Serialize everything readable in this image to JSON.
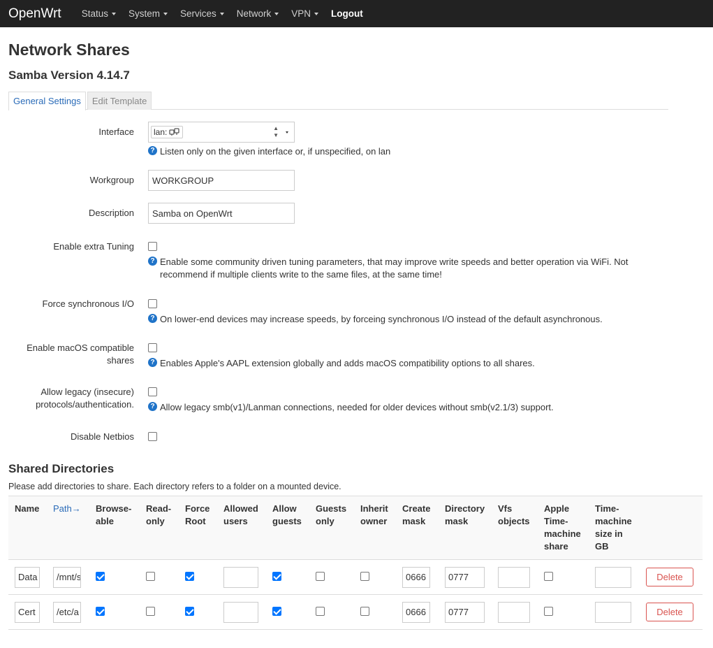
{
  "nav": {
    "brand": "OpenWrt",
    "items": [
      {
        "label": "Status",
        "dropdown": true
      },
      {
        "label": "System",
        "dropdown": true
      },
      {
        "label": "Services",
        "dropdown": true
      },
      {
        "label": "Network",
        "dropdown": true
      },
      {
        "label": "VPN",
        "dropdown": true
      }
    ],
    "logout": "Logout"
  },
  "page": {
    "title": "Network Shares",
    "subtitle": "Samba Version 4.14.7"
  },
  "tabs": [
    {
      "label": "General Settings",
      "active": true
    },
    {
      "label": "Edit Template",
      "active": false
    }
  ],
  "settings": {
    "interface": {
      "label": "Interface",
      "value": "lan:",
      "help": "Listen only on the given interface or, if unspecified, on lan"
    },
    "workgroup": {
      "label": "Workgroup",
      "value": "WORKGROUP"
    },
    "description": {
      "label": "Description",
      "value": "Samba on OpenWrt"
    },
    "extra_tuning": {
      "label": "Enable extra Tuning",
      "checked": false,
      "help": "Enable some community driven tuning parameters, that may improve write speeds and better operation via WiFi. Not recommend if multiple clients write to the same files, at the same time!"
    },
    "sync_io": {
      "label": "Force synchronous I/O",
      "checked": false,
      "help": "On lower-end devices may increase speeds, by forceing synchronous I/O instead of the default asynchronous."
    },
    "macos": {
      "label": "Enable macOS compatible shares",
      "checked": false,
      "help": "Enables Apple's AAPL extension globally and adds macOS compatibility options to all shares."
    },
    "legacy": {
      "label": "Allow legacy (insecure) protocols/authentication.",
      "checked": false,
      "help": "Allow legacy smb(v1)/Lanman connections, needed for older devices without smb(v2.1/3) support."
    },
    "netbios": {
      "label": "Disable Netbios",
      "checked": false
    }
  },
  "shared": {
    "title": "Shared Directories",
    "description": "Please add directories to share. Each directory refers to a folder on a mounted device.",
    "columns": {
      "name": "Name",
      "path": "Path→",
      "browseable": "Browse-able",
      "readonly": "Read-only",
      "forceroot": "Force Root",
      "allowed_users": "Allowed users",
      "allow_guests": "Allow guests",
      "guests_only": "Guests only",
      "inherit_owner": "Inherit owner",
      "create_mask": "Create mask",
      "dir_mask": "Directory mask",
      "vfs": "Vfs objects",
      "timemachine": "Apple Time-machine share",
      "tm_size": "Time-machine size in GB"
    },
    "rows": [
      {
        "name": "Data",
        "path": "/mnt/s",
        "browseable": true,
        "readonly": false,
        "forceroot": true,
        "allowed_users": "",
        "allow_guests": true,
        "guests_only": false,
        "inherit_owner": false,
        "create_mask": "0666",
        "dir_mask": "0777",
        "vfs": "",
        "timemachine": false,
        "tm_size": "",
        "delete": "Delete"
      },
      {
        "name": "Cert",
        "path": "/etc/a",
        "browseable": true,
        "readonly": false,
        "forceroot": true,
        "allowed_users": "",
        "allow_guests": true,
        "guests_only": false,
        "inherit_owner": false,
        "create_mask": "0666",
        "dir_mask": "0777",
        "vfs": "",
        "timemachine": false,
        "tm_size": "",
        "delete": "Delete"
      }
    ]
  },
  "colors": {
    "navbar": "#222222",
    "link": "#2a6bb8",
    "danger": "#d9534f",
    "checkbox": "#0075ff",
    "help_icon": "#1f73c8"
  }
}
